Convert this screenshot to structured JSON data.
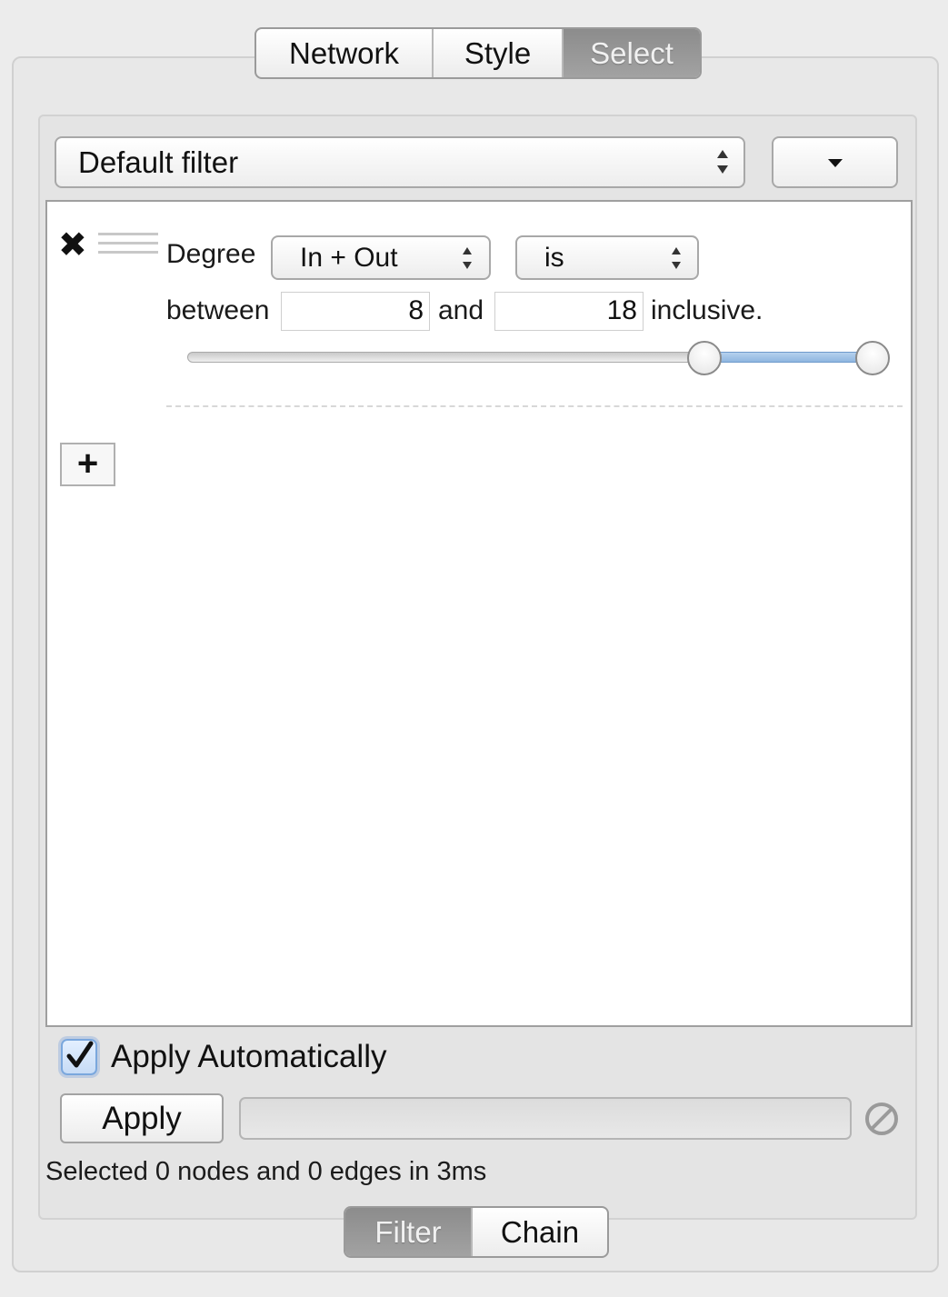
{
  "top_tabs": [
    {
      "label": "Network",
      "selected": false
    },
    {
      "label": "Style",
      "selected": false
    },
    {
      "label": "Select",
      "selected": true
    }
  ],
  "filter_select": {
    "value": "Default filter"
  },
  "filter_menu": {
    "icon": "caret-down-icon"
  },
  "condition": {
    "attribute_label": "Degree",
    "direction": "In + Out",
    "operator": "is",
    "between_label": "between",
    "low": "8",
    "and_label": "and",
    "high": "18",
    "inclusive_label": "inclusive.",
    "range_fraction": {
      "low": 0.75,
      "high": 1.0
    }
  },
  "add_button": {
    "label": "+"
  },
  "apply_auto": {
    "label": "Apply Automatically",
    "checked": true
  },
  "apply_button": {
    "label": "Apply"
  },
  "status": "Selected 0 nodes and 0 edges in 3ms",
  "bottom_tabs": [
    {
      "label": "Filter",
      "selected": true
    },
    {
      "label": "Chain",
      "selected": false
    }
  ],
  "colors": {
    "selected_tab": "#999999",
    "slider_range": "#9fc2e8",
    "check_accent": "#7aa7dd"
  }
}
